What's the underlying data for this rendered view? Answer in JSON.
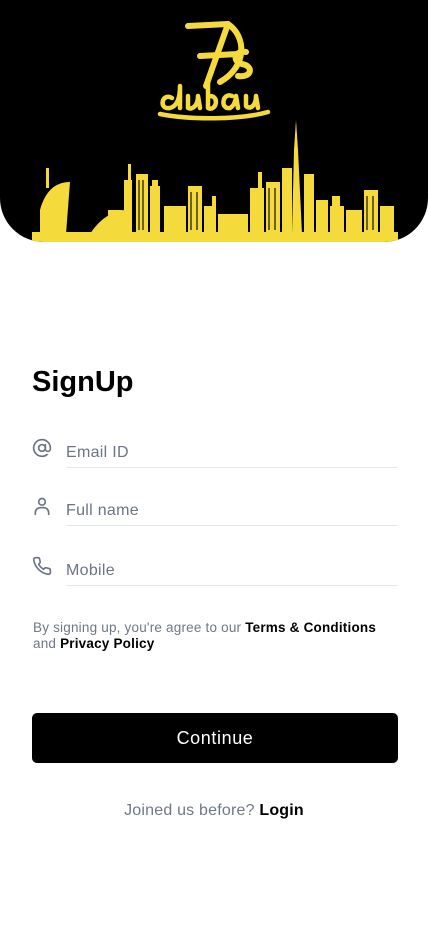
{
  "brand": {
    "logo_text": "Ds dubai",
    "accent_color": "#F5DA3B",
    "header_color": "#000000"
  },
  "signup": {
    "title": "SignUp",
    "fields": {
      "email": {
        "placeholder": "Email ID",
        "value": "",
        "icon": "at-icon"
      },
      "name": {
        "placeholder": "Full name",
        "value": "",
        "icon": "user-icon"
      },
      "mobile": {
        "placeholder": "Mobile",
        "value": "",
        "icon": "phone-icon"
      }
    },
    "terms": {
      "prefix": "By signing up, you're agree to our ",
      "terms_link": "Terms & Conditions",
      "middle": " and ",
      "privacy_link": "Privacy Policy"
    },
    "continue_label": "Continue",
    "login_prompt": "Joined us before? ",
    "login_link": "Login"
  }
}
